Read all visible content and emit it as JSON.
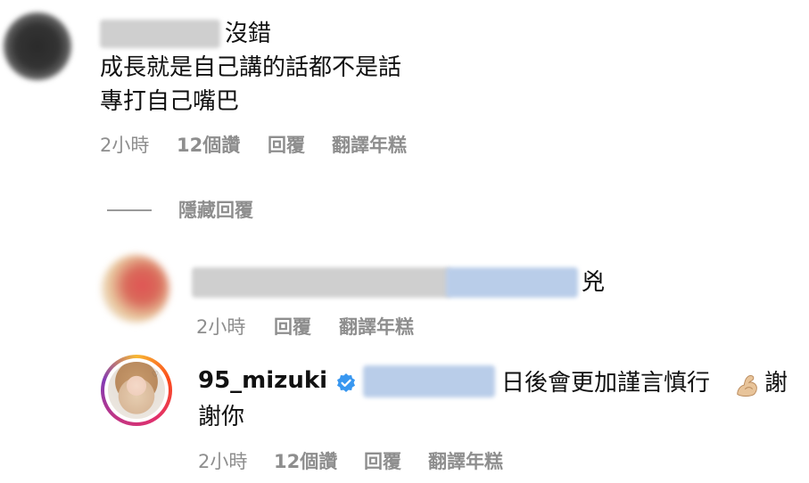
{
  "comment1": {
    "avatar_icon": "blurred-avatar",
    "lines": [
      "沒錯",
      "成長就是自己講的話都不是話",
      "專打自己嘴巴"
    ],
    "meta": {
      "time": "2小時",
      "likes": "12個讚",
      "reply": "回覆",
      "translate": "翻譯年糕"
    }
  },
  "hide_replies": {
    "label": "隱藏回覆"
  },
  "reply1": {
    "avatar_icon": "blurred-avatar",
    "text": "兇",
    "meta": {
      "time": "2小時",
      "reply": "回覆",
      "translate": "翻譯年糕"
    }
  },
  "reply2": {
    "username": "95_mizuki",
    "verified_icon": "verified-badge-icon",
    "text_line1": "日後會更加謹言慎行",
    "emoji_icon": "flexed-biceps-icon",
    "text_line1_end": "謝",
    "text_line2": "謝你",
    "meta": {
      "time": "2小時",
      "likes": "12個讚",
      "reply": "回覆",
      "translate": "翻譯年糕"
    }
  },
  "colors": {
    "meta_gray": "#8e8e8e",
    "verified_blue": "#3897f0",
    "story_ring": "#e1306c"
  }
}
